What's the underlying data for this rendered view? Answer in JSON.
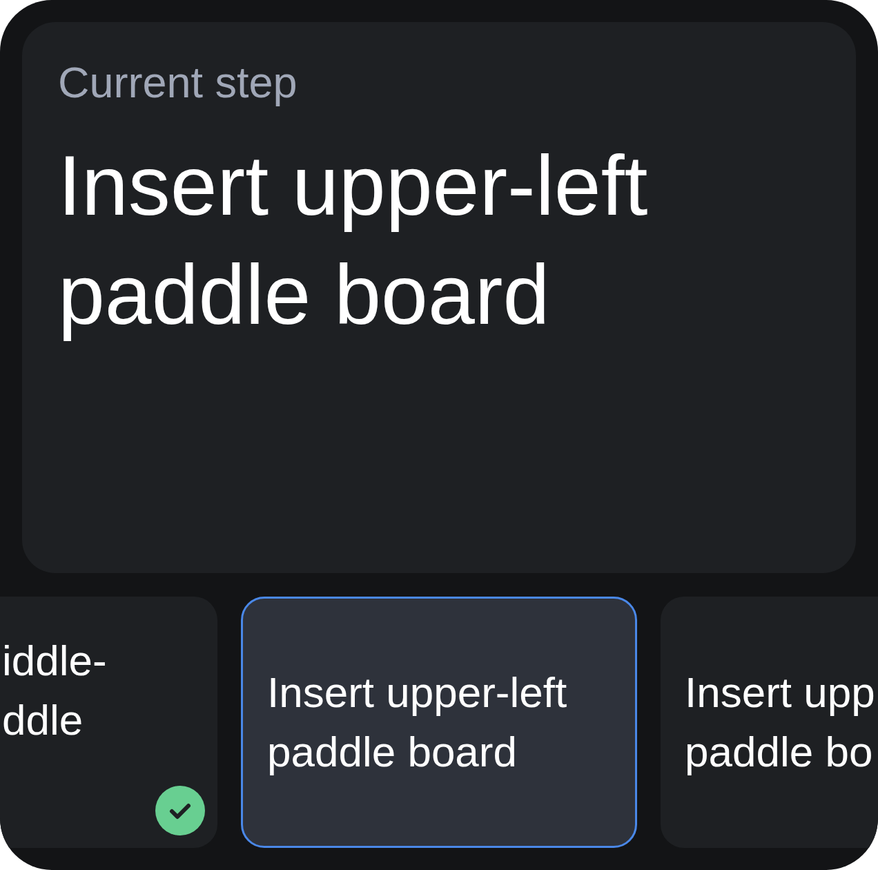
{
  "current_step": {
    "label": "Current step",
    "title": "Insert upper-left paddle board"
  },
  "steps": [
    {
      "lines": [
        "iddle-",
        "ddle"
      ],
      "selected": false,
      "done": true
    },
    {
      "lines": [
        "Insert upper-left",
        "paddle board"
      ],
      "selected": true,
      "done": false
    },
    {
      "lines": [
        "Insert upp",
        "paddle bo"
      ],
      "selected": false,
      "done": false
    }
  ]
}
